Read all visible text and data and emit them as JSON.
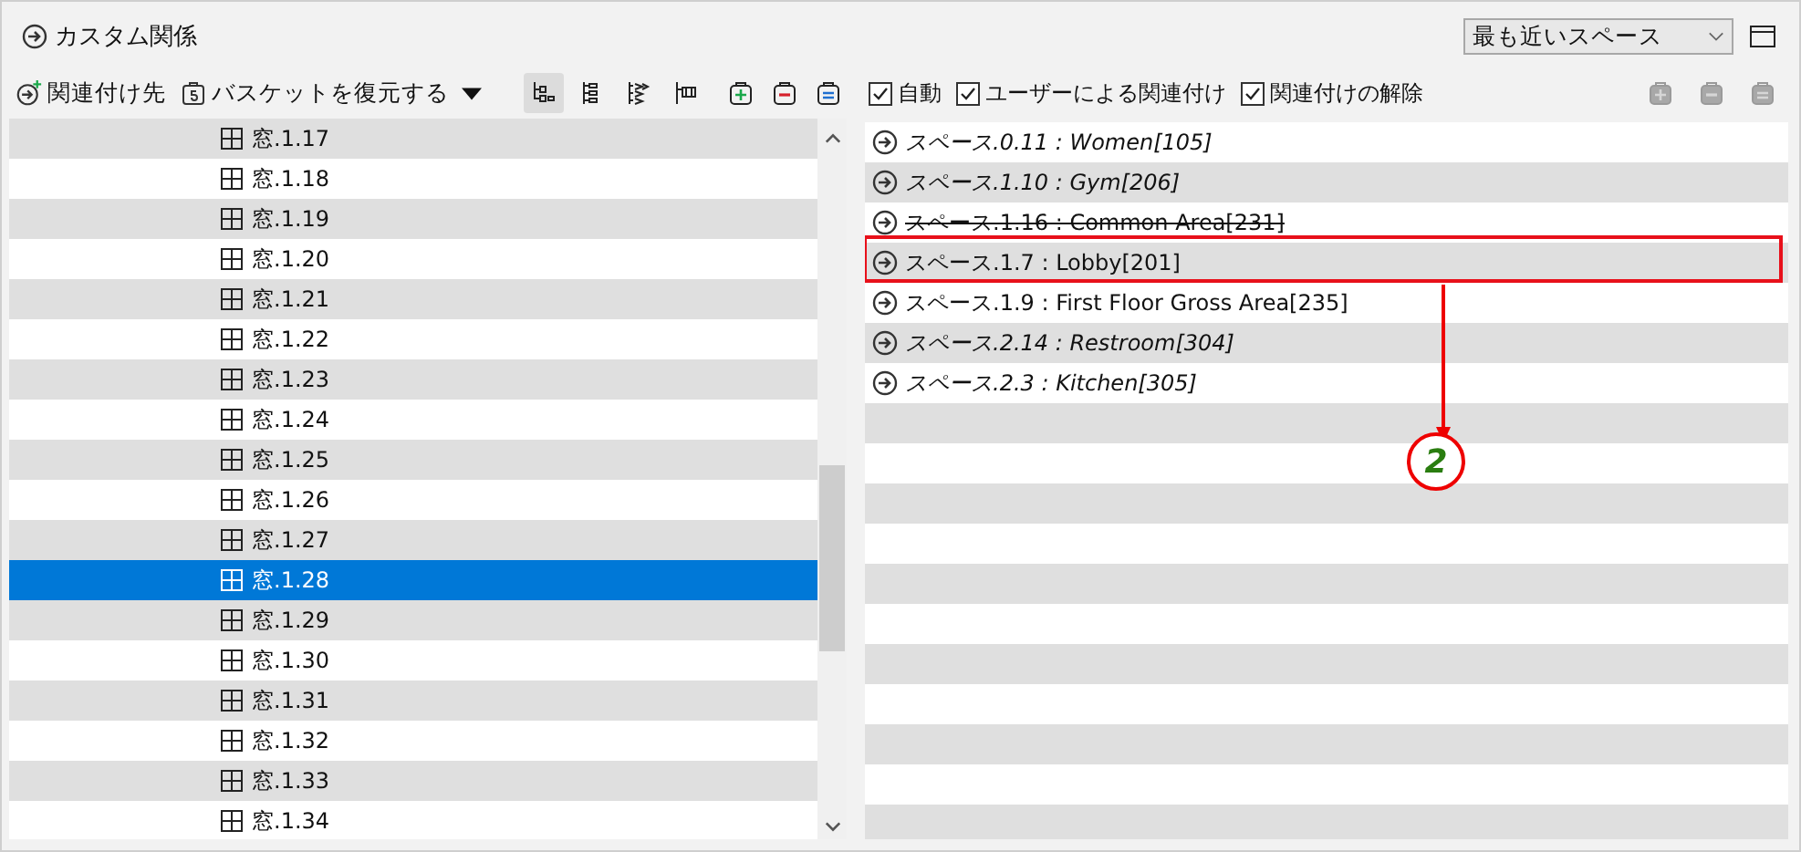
{
  "title": "カスタム関係",
  "scope_dropdown": {
    "value": "最も近いスペース"
  },
  "left_toolbar": {
    "relate_button": "関連付け先",
    "restore_button": "バスケットを復元する",
    "view_buttons": [
      {
        "kind": "tree",
        "selected": true
      },
      {
        "kind": "list",
        "selected": false
      },
      {
        "kind": "layers",
        "selected": false
      },
      {
        "kind": "flow",
        "selected": false
      }
    ],
    "basket_buttons": [
      {
        "kind": "add",
        "disabled": false
      },
      {
        "kind": "remove",
        "disabled": false
      },
      {
        "kind": "equal",
        "disabled": false
      }
    ]
  },
  "right_toolbar": {
    "checkboxes": [
      {
        "label": "自動",
        "checked": true
      },
      {
        "label": "ユーザーによる関連付け",
        "checked": true
      },
      {
        "label": "関連付けの解除",
        "checked": true
      }
    ],
    "basket_buttons": [
      {
        "kind": "add",
        "disabled": true
      },
      {
        "kind": "remove",
        "disabled": true
      },
      {
        "kind": "equal",
        "disabled": true
      }
    ]
  },
  "windows": [
    {
      "label": "窓.1.17",
      "selected": false
    },
    {
      "label": "窓.1.18",
      "selected": false
    },
    {
      "label": "窓.1.19",
      "selected": false
    },
    {
      "label": "窓.1.20",
      "selected": false
    },
    {
      "label": "窓.1.21",
      "selected": false
    },
    {
      "label": "窓.1.22",
      "selected": false
    },
    {
      "label": "窓.1.23",
      "selected": false
    },
    {
      "label": "窓.1.24",
      "selected": false
    },
    {
      "label": "窓.1.25",
      "selected": false
    },
    {
      "label": "窓.1.26",
      "selected": false
    },
    {
      "label": "窓.1.27",
      "selected": false
    },
    {
      "label": "窓.1.28",
      "selected": true
    },
    {
      "label": "窓.1.29",
      "selected": false
    },
    {
      "label": "窓.1.30",
      "selected": false
    },
    {
      "label": "窓.1.31",
      "selected": false
    },
    {
      "label": "窓.1.32",
      "selected": false
    },
    {
      "label": "窓.1.33",
      "selected": false
    },
    {
      "label": "窓.1.34",
      "selected": false
    }
  ],
  "relations": [
    {
      "label": "スペース.0.11 : Women[105]",
      "kind": "automatic",
      "highlighted": false
    },
    {
      "label": "スペース.1.10 : Gym[206]",
      "kind": "automatic",
      "highlighted": false
    },
    {
      "label": "スペース.1.16 : Common Area[231]",
      "kind": "removed",
      "highlighted": false
    },
    {
      "label": "スペース.1.7 : Lobby[201]",
      "kind": "user",
      "highlighted": true
    },
    {
      "label": "スペース.1.9 : First Floor Gross Area[235]",
      "kind": "user",
      "highlighted": false
    },
    {
      "label": "スペース.2.14 : Restroom[304]",
      "kind": "automatic",
      "highlighted": false
    },
    {
      "label": "スペース.2.3 : Kitchen[305]",
      "kind": "automatic",
      "highlighted": false
    }
  ],
  "callout": {
    "label": "2"
  }
}
